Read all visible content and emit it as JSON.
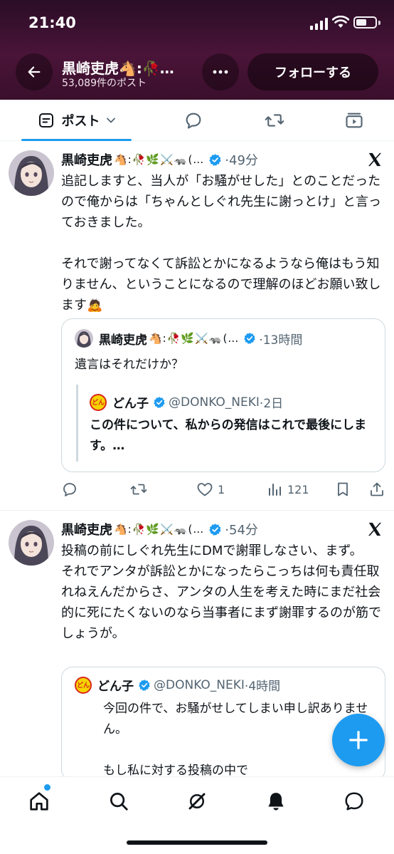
{
  "status_bar": {
    "time": "21:40"
  },
  "header": {
    "name": "黒崎吏虎🐴:🥀…",
    "post_count": "53,089件のポスト",
    "follow_label": "フォローする"
  },
  "tabs": [
    {
      "label": "ポスト",
      "selected": true
    },
    {
      "icon": "reply-icon"
    },
    {
      "icon": "retweet-icon"
    },
    {
      "icon": "media-icon"
    }
  ],
  "posts": [
    {
      "author": "黒崎吏虎",
      "emojis": "🐴:🥀🌿⚔️🦡(…",
      "time": "·49分",
      "text": "追記しますと、当人が「お騒がせした」とのことだったので俺からは「ちゃんとしぐれ先生に謝っとけ」と言っておきました。\n\nそれで謝ってなくて訴訟とかになるようなら俺はもう知りません、ということになるので理解のほどお願い致します🙇",
      "quote": {
        "author": "黒崎吏虎",
        "emojis": "🐴:🥀🌿⚔️🦡(…",
        "time": "·13時間",
        "text": "遺言はそれだけか？",
        "nested": {
          "author": "どん子",
          "handle": "@DONKO_NEKI",
          "time": "·2日",
          "text": "この件について、私からの発信はこれで最後にします。…"
        }
      },
      "actions": {
        "replies": "",
        "reposts": "",
        "likes": "1",
        "views": "121"
      }
    },
    {
      "author": "黒崎吏虎",
      "emojis": "🐴:🥀🌿⚔️🦡(…",
      "time": "·54分",
      "text": "投稿の前にしぐれ先生にDMで謝罪しなさい、まず。\nそれでアンタが訴訟とかになったらこっちは何も責任取れねえんだからさ、アンタの人生を考えた時にまだ社会的に死にたくないのなら当事者にまず謝罪するのが筋でしょうが。",
      "quote": {
        "author": "どん子",
        "handle": "@DONKO_NEKI",
        "time": "·4時間",
        "text": "今回の件で、お騒がせしてしまい申し訳ありません。\n\nもし私に対する投稿の中で"
      }
    }
  ],
  "donko_icon_text": "どん",
  "colors": {
    "accent": "#1d9bf0",
    "header_bg": "#3a0f2c",
    "secondary_text": "#536471"
  }
}
